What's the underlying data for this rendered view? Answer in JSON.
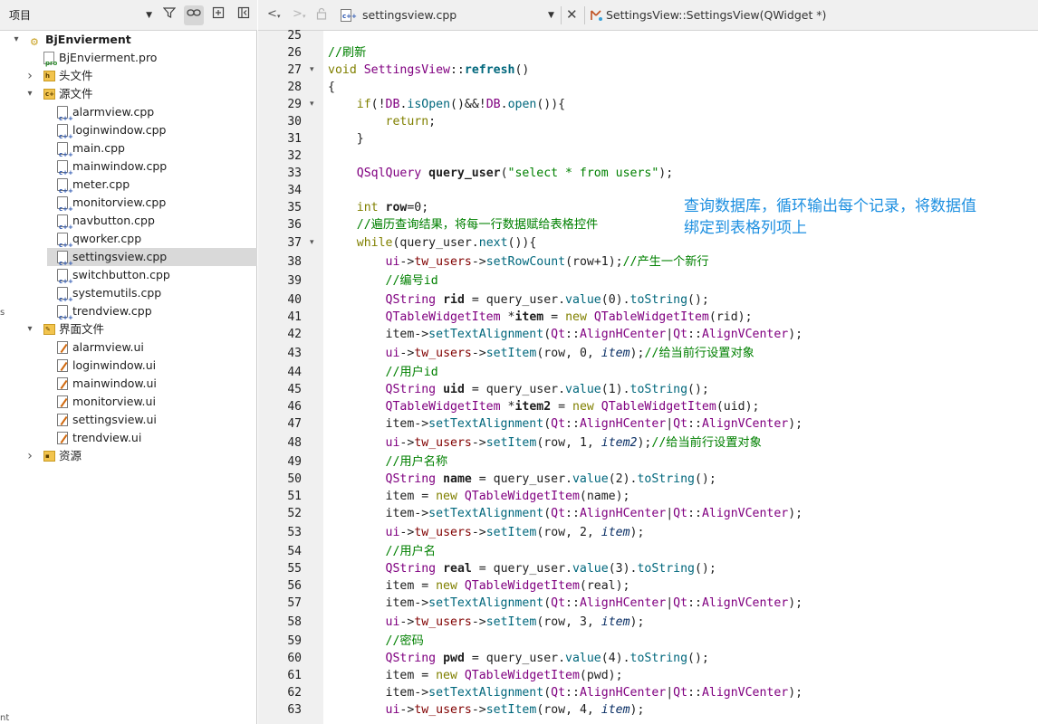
{
  "project_panel": {
    "combo_label": "项目",
    "tree": [
      {
        "label": "BjEnvierment",
        "icon": "project-icon",
        "twisty": "▾",
        "bold": true
      },
      {
        "label": "BjEnvierment.pro",
        "icon": "pro-file-icon"
      },
      {
        "label": "头文件",
        "icon": "header-folder-icon",
        "twisty": "›"
      },
      {
        "label": "源文件",
        "icon": "source-folder-icon",
        "twisty": "▾"
      },
      {
        "label": "alarmview.cpp",
        "icon": "cpp-file-icon"
      },
      {
        "label": "loginwindow.cpp",
        "icon": "cpp-file-icon"
      },
      {
        "label": "main.cpp",
        "icon": "cpp-file-icon"
      },
      {
        "label": "mainwindow.cpp",
        "icon": "cpp-file-icon"
      },
      {
        "label": "meter.cpp",
        "icon": "cpp-file-icon"
      },
      {
        "label": "monitorview.cpp",
        "icon": "cpp-file-icon"
      },
      {
        "label": "navbutton.cpp",
        "icon": "cpp-file-icon"
      },
      {
        "label": "qworker.cpp",
        "icon": "cpp-file-icon"
      },
      {
        "label": "settingsview.cpp",
        "icon": "cpp-file-icon",
        "selected": true
      },
      {
        "label": "switchbutton.cpp",
        "icon": "cpp-file-icon"
      },
      {
        "label": "systemutils.cpp",
        "icon": "cpp-file-icon"
      },
      {
        "label": "trendview.cpp",
        "icon": "cpp-file-icon"
      },
      {
        "label": "界面文件",
        "icon": "forms-folder-icon",
        "twisty": "▾"
      },
      {
        "label": "alarmview.ui",
        "icon": "ui-file-icon"
      },
      {
        "label": "loginwindow.ui",
        "icon": "ui-file-icon"
      },
      {
        "label": "mainwindow.ui",
        "icon": "ui-file-icon"
      },
      {
        "label": "monitorview.ui",
        "icon": "ui-file-icon"
      },
      {
        "label": "settingsview.ui",
        "icon": "ui-file-icon"
      },
      {
        "label": "trendview.ui",
        "icon": "ui-file-icon"
      },
      {
        "label": "资源",
        "icon": "resource-folder-icon",
        "twisty": "›"
      }
    ],
    "edge_marks": [
      "s",
      "nt"
    ]
  },
  "editor": {
    "file_name": "settingsview.cpp",
    "symbol": "SettingsView::SettingsView(QWidget *)",
    "lines": [
      {
        "n": 25,
        "tokens": []
      },
      {
        "n": 26,
        "tokens": [
          [
            "cm",
            "//刷新"
          ]
        ]
      },
      {
        "n": 27,
        "fold": true,
        "tokens": [
          [
            "kw",
            "void "
          ],
          [
            "ty",
            "SettingsView"
          ],
          [
            "",
            "::"
          ],
          [
            "fb",
            "refresh"
          ],
          [
            "",
            "()"
          ]
        ]
      },
      {
        "n": 28,
        "tokens": [
          [
            "",
            "{"
          ]
        ]
      },
      {
        "n": 29,
        "fold": true,
        "tokens": [
          [
            "",
            "    "
          ],
          [
            "kw",
            "if"
          ],
          [
            "",
            "(!"
          ],
          [
            "ty",
            "DB"
          ],
          [
            "",
            "."
          ],
          [
            "fn",
            "isOpen"
          ],
          [
            "",
            "()&&!"
          ],
          [
            "ty",
            "DB"
          ],
          [
            "",
            "."
          ],
          [
            "fn",
            "open"
          ],
          [
            "",
            "()){"
          ]
        ]
      },
      {
        "n": 30,
        "tokens": [
          [
            "",
            "        "
          ],
          [
            "kw",
            "return"
          ],
          [
            "",
            ";"
          ]
        ]
      },
      {
        "n": 31,
        "tokens": [
          [
            "",
            "    }"
          ]
        ]
      },
      {
        "n": 32,
        "tokens": []
      },
      {
        "n": 33,
        "tokens": [
          [
            "",
            "    "
          ],
          [
            "ty",
            "QSqlQuery "
          ],
          [
            "vb",
            "query_user"
          ],
          [
            "",
            "("
          ],
          [
            "st",
            "\"select * from users\""
          ],
          [
            "",
            ");"
          ]
        ]
      },
      {
        "n": 34,
        "tokens": []
      },
      {
        "n": 35,
        "tokens": [
          [
            "",
            "    "
          ],
          [
            "kw",
            "int "
          ],
          [
            "vb",
            "row"
          ],
          [
            "",
            "=0;"
          ]
        ]
      },
      {
        "n": 36,
        "tokens": [
          [
            "",
            "    "
          ],
          [
            "cm",
            "//遍历查询结果，将每一行数据赋给表格控件"
          ]
        ]
      },
      {
        "n": 37,
        "fold": true,
        "tokens": [
          [
            "",
            "    "
          ],
          [
            "kw",
            "while"
          ],
          [
            "",
            "(query_user."
          ],
          [
            "fn",
            "next"
          ],
          [
            "",
            "()){"
          ]
        ]
      },
      {
        "n": 38,
        "tokens": [
          [
            "",
            "        "
          ],
          [
            "ty",
            "ui"
          ],
          [
            "",
            "->"
          ],
          [
            "mb",
            "tw_users"
          ],
          [
            "",
            "->"
          ],
          [
            "fn",
            "setRowCount"
          ],
          [
            "",
            "(row+1);"
          ],
          [
            "cm",
            "//产生一个新行"
          ]
        ]
      },
      {
        "n": 39,
        "tokens": [
          [
            "",
            "        "
          ],
          [
            "cm",
            "//编号id"
          ]
        ]
      },
      {
        "n": 40,
        "tokens": [
          [
            "",
            "        "
          ],
          [
            "ty",
            "QString "
          ],
          [
            "vb",
            "rid"
          ],
          [
            "",
            " = query_user."
          ],
          [
            "fn",
            "value"
          ],
          [
            "",
            "(0)."
          ],
          [
            "fn",
            "toString"
          ],
          [
            "",
            "();"
          ]
        ]
      },
      {
        "n": 41,
        "tokens": [
          [
            "",
            "        "
          ],
          [
            "ty",
            "QTableWidgetItem "
          ],
          [
            "",
            "*"
          ],
          [
            "vb",
            "item"
          ],
          [
            "",
            " = "
          ],
          [
            "kw",
            "new "
          ],
          [
            "ty",
            "QTableWidgetItem"
          ],
          [
            "",
            "(rid);"
          ]
        ]
      },
      {
        "n": 42,
        "tokens": [
          [
            "",
            "        item->"
          ],
          [
            "fn",
            "setTextAlignment"
          ],
          [
            "",
            "("
          ],
          [
            "ns",
            "Qt"
          ],
          [
            "",
            "::"
          ],
          [
            "ty",
            "AlignHCenter"
          ],
          [
            "",
            "|"
          ],
          [
            "ns",
            "Qt"
          ],
          [
            "",
            "::"
          ],
          [
            "ty",
            "AlignVCenter"
          ],
          [
            "",
            ");"
          ]
        ]
      },
      {
        "n": 43,
        "tokens": [
          [
            "",
            "        "
          ],
          [
            "ty",
            "ui"
          ],
          [
            "",
            "->"
          ],
          [
            "mb",
            "tw_users"
          ],
          [
            "",
            "->"
          ],
          [
            "fn",
            "setItem"
          ],
          [
            "",
            "(row, 0, "
          ],
          [
            "it",
            "item"
          ],
          [
            "",
            ");"
          ],
          [
            "cm",
            "//给当前行设置对象"
          ]
        ]
      },
      {
        "n": 44,
        "tokens": [
          [
            "",
            "        "
          ],
          [
            "cm",
            "//用户id"
          ]
        ]
      },
      {
        "n": 45,
        "tokens": [
          [
            "",
            "        "
          ],
          [
            "ty",
            "QString "
          ],
          [
            "vb",
            "uid"
          ],
          [
            "",
            " = query_user."
          ],
          [
            "fn",
            "value"
          ],
          [
            "",
            "(1)."
          ],
          [
            "fn",
            "toString"
          ],
          [
            "",
            "();"
          ]
        ]
      },
      {
        "n": 46,
        "tokens": [
          [
            "",
            "        "
          ],
          [
            "ty",
            "QTableWidgetItem "
          ],
          [
            "",
            "*"
          ],
          [
            "vb",
            "item2"
          ],
          [
            "",
            " = "
          ],
          [
            "kw",
            "new "
          ],
          [
            "ty",
            "QTableWidgetItem"
          ],
          [
            "",
            "(uid);"
          ]
        ]
      },
      {
        "n": 47,
        "tokens": [
          [
            "",
            "        item->"
          ],
          [
            "fn",
            "setTextAlignment"
          ],
          [
            "",
            "("
          ],
          [
            "ns",
            "Qt"
          ],
          [
            "",
            "::"
          ],
          [
            "ty",
            "AlignHCenter"
          ],
          [
            "",
            "|"
          ],
          [
            "ns",
            "Qt"
          ],
          [
            "",
            "::"
          ],
          [
            "ty",
            "AlignVCenter"
          ],
          [
            "",
            ");"
          ]
        ]
      },
      {
        "n": 48,
        "tokens": [
          [
            "",
            "        "
          ],
          [
            "ty",
            "ui"
          ],
          [
            "",
            "->"
          ],
          [
            "mb",
            "tw_users"
          ],
          [
            "",
            "->"
          ],
          [
            "fn",
            "setItem"
          ],
          [
            "",
            "(row, 1, "
          ],
          [
            "it",
            "item2"
          ],
          [
            "",
            ");"
          ],
          [
            "cm",
            "//给当前行设置对象"
          ]
        ]
      },
      {
        "n": 49,
        "tokens": [
          [
            "",
            "        "
          ],
          [
            "cm",
            "//用户名称"
          ]
        ]
      },
      {
        "n": 50,
        "tokens": [
          [
            "",
            "        "
          ],
          [
            "ty",
            "QString "
          ],
          [
            "vb",
            "name"
          ],
          [
            "",
            " = query_user."
          ],
          [
            "fn",
            "value"
          ],
          [
            "",
            "(2)."
          ],
          [
            "fn",
            "toString"
          ],
          [
            "",
            "();"
          ]
        ]
      },
      {
        "n": 51,
        "tokens": [
          [
            "",
            "        item = "
          ],
          [
            "kw",
            "new "
          ],
          [
            "ty",
            "QTableWidgetItem"
          ],
          [
            "",
            "(name);"
          ]
        ]
      },
      {
        "n": 52,
        "tokens": [
          [
            "",
            "        item->"
          ],
          [
            "fn",
            "setTextAlignment"
          ],
          [
            "",
            "("
          ],
          [
            "ns",
            "Qt"
          ],
          [
            "",
            "::"
          ],
          [
            "ty",
            "AlignHCenter"
          ],
          [
            "",
            "|"
          ],
          [
            "ns",
            "Qt"
          ],
          [
            "",
            "::"
          ],
          [
            "ty",
            "AlignVCenter"
          ],
          [
            "",
            ");"
          ]
        ]
      },
      {
        "n": 53,
        "tokens": [
          [
            "",
            "        "
          ],
          [
            "ty",
            "ui"
          ],
          [
            "",
            "->"
          ],
          [
            "mb",
            "tw_users"
          ],
          [
            "",
            "->"
          ],
          [
            "fn",
            "setItem"
          ],
          [
            "",
            "(row, 2, "
          ],
          [
            "it",
            "item"
          ],
          [
            "",
            ");"
          ]
        ]
      },
      {
        "n": 54,
        "tokens": [
          [
            "",
            "        "
          ],
          [
            "cm",
            "//用户名"
          ]
        ]
      },
      {
        "n": 55,
        "tokens": [
          [
            "",
            "        "
          ],
          [
            "ty",
            "QString "
          ],
          [
            "vb",
            "real"
          ],
          [
            "",
            " = query_user."
          ],
          [
            "fn",
            "value"
          ],
          [
            "",
            "(3)."
          ],
          [
            "fn",
            "toString"
          ],
          [
            "",
            "();"
          ]
        ]
      },
      {
        "n": 56,
        "tokens": [
          [
            "",
            "        item = "
          ],
          [
            "kw",
            "new "
          ],
          [
            "ty",
            "QTableWidgetItem"
          ],
          [
            "",
            "(real);"
          ]
        ]
      },
      {
        "n": 57,
        "tokens": [
          [
            "",
            "        item->"
          ],
          [
            "fn",
            "setTextAlignment"
          ],
          [
            "",
            "("
          ],
          [
            "ns",
            "Qt"
          ],
          [
            "",
            "::"
          ],
          [
            "ty",
            "AlignHCenter"
          ],
          [
            "",
            "|"
          ],
          [
            "ns",
            "Qt"
          ],
          [
            "",
            "::"
          ],
          [
            "ty",
            "AlignVCenter"
          ],
          [
            "",
            ");"
          ]
        ]
      },
      {
        "n": 58,
        "tokens": [
          [
            "",
            "        "
          ],
          [
            "ty",
            "ui"
          ],
          [
            "",
            "->"
          ],
          [
            "mb",
            "tw_users"
          ],
          [
            "",
            "->"
          ],
          [
            "fn",
            "setItem"
          ],
          [
            "",
            "(row, 3, "
          ],
          [
            "it",
            "item"
          ],
          [
            "",
            ");"
          ]
        ]
      },
      {
        "n": 59,
        "tokens": [
          [
            "",
            "        "
          ],
          [
            "cm",
            "//密码"
          ]
        ]
      },
      {
        "n": 60,
        "tokens": [
          [
            "",
            "        "
          ],
          [
            "ty",
            "QString "
          ],
          [
            "vb",
            "pwd"
          ],
          [
            "",
            " = query_user."
          ],
          [
            "fn",
            "value"
          ],
          [
            "",
            "(4)."
          ],
          [
            "fn",
            "toString"
          ],
          [
            "",
            "();"
          ]
        ]
      },
      {
        "n": 61,
        "tokens": [
          [
            "",
            "        item = "
          ],
          [
            "kw",
            "new "
          ],
          [
            "ty",
            "QTableWidgetItem"
          ],
          [
            "",
            "(pwd);"
          ]
        ]
      },
      {
        "n": 62,
        "tokens": [
          [
            "",
            "        item->"
          ],
          [
            "fn",
            "setTextAlignment"
          ],
          [
            "",
            "("
          ],
          [
            "ns",
            "Qt"
          ],
          [
            "",
            "::"
          ],
          [
            "ty",
            "AlignHCenter"
          ],
          [
            "",
            "|"
          ],
          [
            "ns",
            "Qt"
          ],
          [
            "",
            "::"
          ],
          [
            "ty",
            "AlignVCenter"
          ],
          [
            "",
            ");"
          ]
        ]
      },
      {
        "n": 63,
        "tokens": [
          [
            "",
            "        "
          ],
          [
            "ty",
            "ui"
          ],
          [
            "",
            "->"
          ],
          [
            "mb",
            "tw_users"
          ],
          [
            "",
            "->"
          ],
          [
            "fn",
            "setItem"
          ],
          [
            "",
            "(row, 4, "
          ],
          [
            "it",
            "item"
          ],
          [
            "",
            ");"
          ]
        ]
      }
    ]
  },
  "annotation": {
    "line1": "查询数据库，循环输出每个记录，将数据值",
    "line2": "绑定到表格列项上"
  },
  "colors": {
    "annotation": "#1d8fe0",
    "keyword": "#808000",
    "type": "#800080",
    "function": "#00677c",
    "comment": "#008000",
    "member": "#800000"
  }
}
